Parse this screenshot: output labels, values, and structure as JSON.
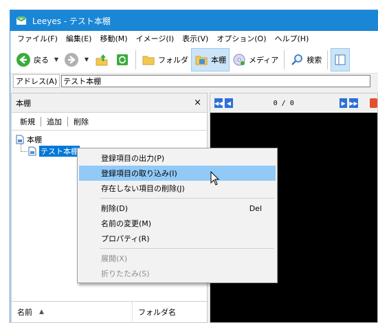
{
  "window": {
    "title": "Leeyes - テスト本棚"
  },
  "menu": [
    "ファイル(F)",
    "編集(E)",
    "移動(M)",
    "イメージ(I)",
    "表示(V)",
    "オプション(O)",
    "ヘルプ(H)"
  ],
  "toolbar": {
    "back_label": "戻る",
    "folder_label": "フォルダ",
    "bookshelf_label": "本棚",
    "media_label": "メディア",
    "search_label": "検索"
  },
  "address": {
    "label": "アドレス(A)",
    "value": "テスト本棚"
  },
  "left_pane": {
    "title": "本棚",
    "close": "×",
    "actions": {
      "new": "新規",
      "add": "追加",
      "delete": "削除"
    },
    "tree": {
      "root": "本棚",
      "child": "テスト本棚"
    },
    "list_columns": {
      "name": "名前",
      "folder": "フォルダ名"
    }
  },
  "viewer": {
    "counter": "0 / 0"
  },
  "context_menu": {
    "items": [
      {
        "label": "登録項目の出力(P)"
      },
      {
        "label": "登録項目の取り込み(I)"
      },
      {
        "label": "存在しない項目の削除(J)"
      },
      {
        "label": "削除(D)",
        "shortcut": "Del"
      },
      {
        "label": "名前の変更(M)"
      },
      {
        "label": "プロパティ(R)"
      },
      {
        "label": "展開(X)"
      },
      {
        "label": "折りたたみ(S)"
      }
    ]
  },
  "colors": {
    "titlebar": "#1b86d6",
    "selection": "#0078d7",
    "menu_highlight": "#91c9f7",
    "viewer_bg": "#000000"
  }
}
